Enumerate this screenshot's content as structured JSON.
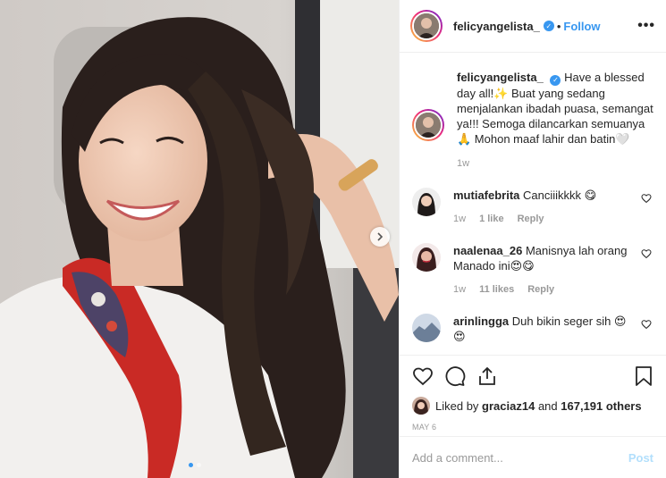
{
  "post": {
    "username": "felicyangelista_",
    "follow_label": "Follow",
    "separator": "•",
    "more_label": "•••"
  },
  "caption": {
    "username": "felicyangelista_",
    "text": "Have a blessed day all!✨ Buat yang sedang menjalankan ibadah puasa, semangat ya!!! Semoga dilancarkan semuanya🙏 Mohon maaf lahir dan batin🤍",
    "age": "1w"
  },
  "comments": [
    {
      "username": "mutiafebrita",
      "text": "Canciiikkkk 😋",
      "age": "1w",
      "likes": "1 like",
      "reply": "Reply"
    },
    {
      "username": "naalenaa_26",
      "text": "Manisnya lah orang Manado ini😍😋",
      "age": "1w",
      "likes": "11 likes",
      "reply": "Reply"
    },
    {
      "username": "arinlingga",
      "text": "Duh bikin seger sih 😍😍"
    }
  ],
  "likes": {
    "prefix": "Liked by",
    "user": "graciaz14",
    "and": "and",
    "count": "167,191 others"
  },
  "date": "MAY 6",
  "add_comment": {
    "placeholder": "Add a comment...",
    "post_label": "Post"
  },
  "colors": {
    "accent": "#3897f0",
    "muted": "#999999",
    "post_disabled": "#b2dffc"
  },
  "icons": [
    "verified-icon",
    "more-icon",
    "heart-icon",
    "comment-icon",
    "share-icon",
    "bookmark-icon",
    "chevron-right-icon"
  ]
}
